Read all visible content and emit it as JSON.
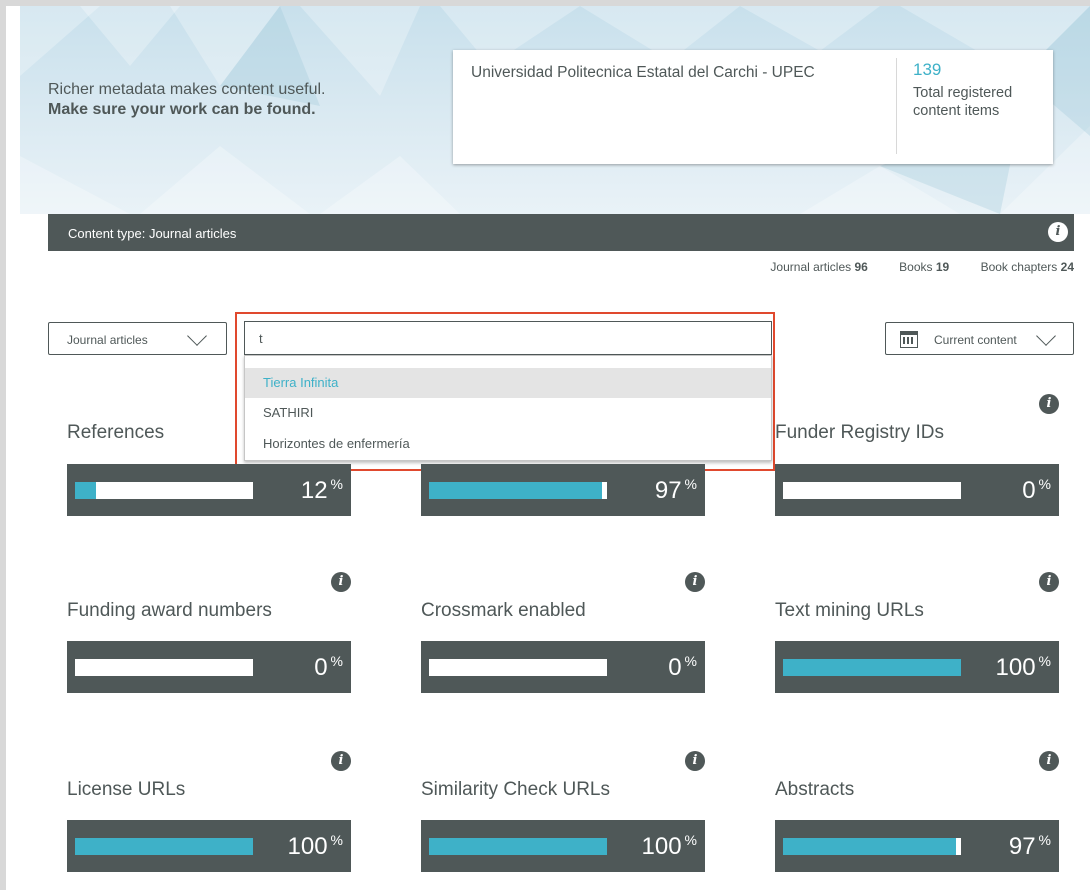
{
  "hero": {
    "tagline": "Richer metadata makes content useful.",
    "tagline_bold": "Make sure your work can be found."
  },
  "organization": {
    "name": "Universidad Politecnica Estatal del Carchi - UPEC",
    "total_items": "139",
    "total_items_label": "Total registered content items"
  },
  "content_type_bar": {
    "label": "Content type: Journal articles",
    "info_icon": "info-icon"
  },
  "type_counts": [
    {
      "label": "Journal articles",
      "count": "96"
    },
    {
      "label": "Books",
      "count": "19"
    },
    {
      "label": "Book chapters",
      "count": "24"
    }
  ],
  "filters": {
    "content_type_select": "Journal articles",
    "search_value": "t",
    "period_select": "Current content",
    "period_icon": "calendar-icon"
  },
  "autocomplete": {
    "items": [
      "Tierra Infinita",
      "SATHIRI",
      "Horizontes de enfermería"
    ],
    "highlighted_index": 0
  },
  "metrics": [
    {
      "label": "References",
      "value": 12,
      "display": "12",
      "unit": "%",
      "has_info": false
    },
    {
      "label": "",
      "value": 97,
      "display": "97",
      "unit": "%",
      "has_info": false
    },
    {
      "label": "Funder Registry IDs",
      "value": 0,
      "display": "0",
      "unit": "%",
      "has_info": true
    },
    {
      "label": "Funding award numbers",
      "value": 0,
      "display": "0",
      "unit": "%",
      "has_info": true
    },
    {
      "label": "Crossmark enabled",
      "value": 0,
      "display": "0",
      "unit": "%",
      "has_info": true
    },
    {
      "label": "Text mining URLs",
      "value": 100,
      "display": "100",
      "unit": "%",
      "has_info": true
    },
    {
      "label": "License URLs",
      "value": 100,
      "display": "100",
      "unit": "%",
      "has_info": true
    },
    {
      "label": "Similarity Check URLs",
      "value": 100,
      "display": "100",
      "unit": "%",
      "has_info": true
    },
    {
      "label": "Abstracts",
      "value": 97,
      "display": "97",
      "unit": "%",
      "has_info": true
    }
  ],
  "colors": {
    "accent": "#3eb1c8",
    "dark": "#4f5858",
    "highlight_border": "#e0492e"
  }
}
